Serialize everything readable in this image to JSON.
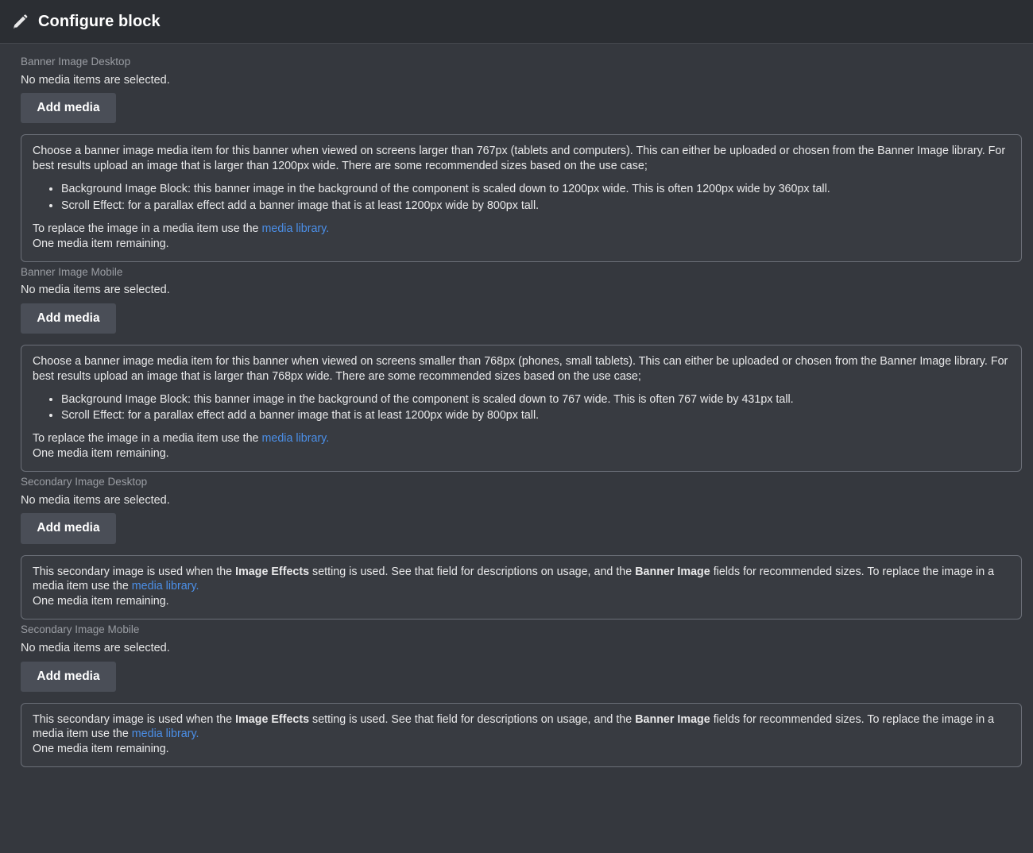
{
  "header": {
    "title": "Configure block",
    "icon": "pencil-icon"
  },
  "common": {
    "no_media_text": "No media items are selected.",
    "add_media_label": "Add media",
    "replace_prefix": "To replace the image in a media item use the ",
    "media_library_link": "media library.",
    "remaining_text": "One media item remaining.",
    "link_color": "#4b8fe8",
    "label_color": "#9a9da3",
    "button_bg": "#4a4e57",
    "panel_bg": "#35383e",
    "header_bg": "#2b2e33",
    "box_border": "#6b6f78"
  },
  "fields": [
    {
      "id": "banner-image-desktop",
      "label": "Banner Image Desktop",
      "status": "No media items are selected.",
      "button": "Add media",
      "description": {
        "type": "banner",
        "intro": "Choose a banner image media item for this banner when viewed on screens larger than 767px (tablets and computers). This can either be uploaded or chosen from the Banner Image library. For best results upload an image that is larger than 1200px wide. There are some recommended sizes based on the use case;",
        "bullets": [
          "Background Image Block: this banner image in the background of the component is scaled down to 1200px wide. This is often 1200px wide by 360px tall.",
          "Scroll Effect: for a parallax effect add a banner image that is at least 1200px wide by 800px tall."
        ],
        "replace_line_prefix": "To replace the image in a media item use the ",
        "replace_link": "media library.",
        "remaining": "One media item remaining."
      }
    },
    {
      "id": "banner-image-mobile",
      "label": "Banner Image Mobile",
      "status": "No media items are selected.",
      "button": "Add media",
      "description": {
        "type": "banner",
        "intro": "Choose a banner image media item for this banner when viewed on screens smaller than 768px (phones, small tablets). This can either be uploaded or chosen from the Banner Image library. For best results upload an image that is larger than 768px wide. There are some recommended sizes based on the use case;",
        "bullets": [
          "Background Image Block: this banner image in the background of the component is scaled down to 767 wide. This is often 767 wide by 431px tall.",
          "Scroll Effect: for a parallax effect add a banner image that is at least 1200px wide by 800px tall."
        ],
        "replace_line_prefix": "To replace the image in a media item use the ",
        "replace_link": "media library.",
        "remaining": "One media item remaining."
      }
    },
    {
      "id": "secondary-image-desktop",
      "label": "Secondary Image Desktop",
      "status": "No media items are selected.",
      "button": "Add media",
      "description": {
        "type": "secondary",
        "part1": "This secondary image is used when the ",
        "term1": "Image Effects",
        "part2": " setting is used. See that field for descriptions on usage, and the ",
        "term2": "Banner Image",
        "part3": " fields for recommended sizes. To replace the image in a media item use the ",
        "replace_link": "media library.",
        "remaining": "One media item remaining."
      }
    },
    {
      "id": "secondary-image-mobile",
      "label": "Secondary Image Mobile",
      "status": "No media items are selected.",
      "button": "Add media",
      "description": {
        "type": "secondary",
        "part1": "This secondary image is used when the ",
        "term1": "Image Effects",
        "part2": " setting is used. See that field for descriptions on usage, and the ",
        "term2": "Banner Image",
        "part3": " fields for recommended sizes. To replace the image in a media item use the ",
        "replace_link": "media library.",
        "remaining": "One media item remaining."
      }
    }
  ]
}
